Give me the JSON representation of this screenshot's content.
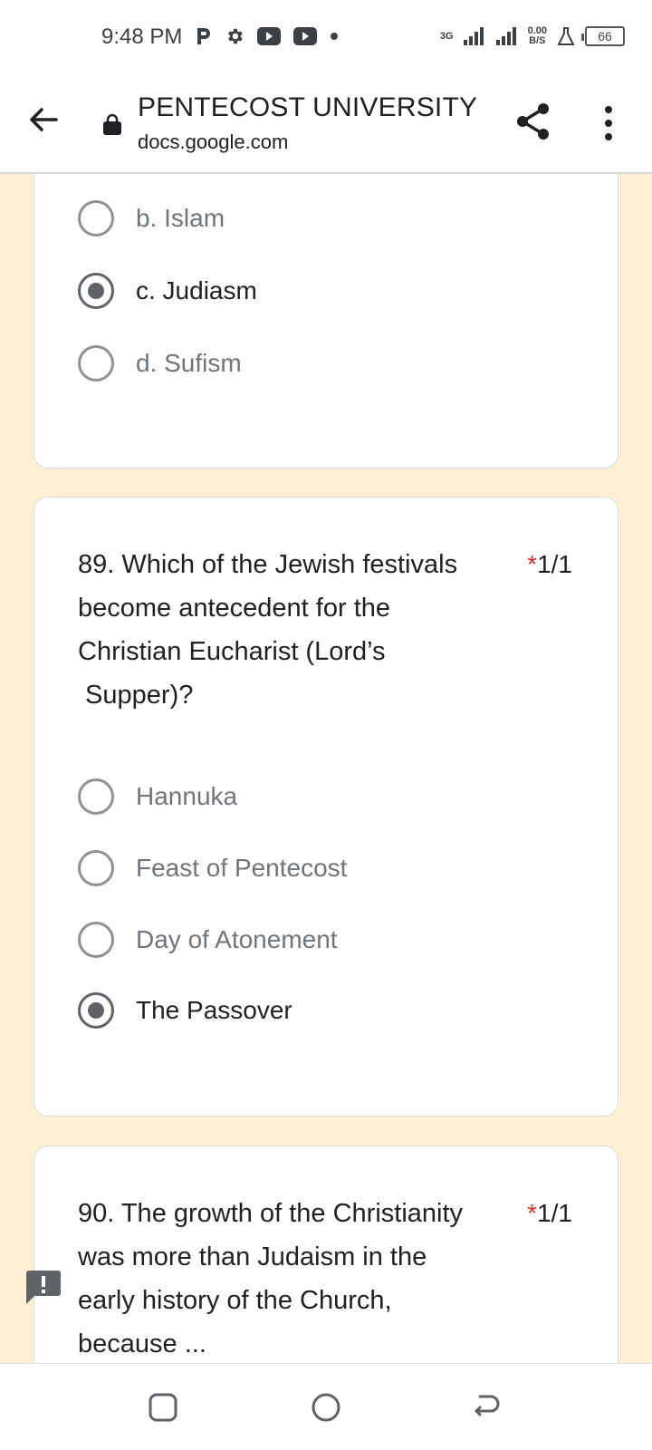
{
  "status_bar": {
    "time": "9:48 PM",
    "network_type": "3G",
    "data_speed_value": "0.00",
    "data_speed_unit": "B/S",
    "battery": "66",
    "left_icons": [
      "p-app-icon",
      "gear-icon",
      "video-icon",
      "youtube-icon",
      "dot-icon"
    ]
  },
  "app_bar": {
    "title": "PENTECOST UNIVERSITY",
    "url": "docs.google.com"
  },
  "card1": {
    "options": [
      {
        "label": "b. Islam",
        "selected": false
      },
      {
        "label": "c. Judiasm",
        "selected": true
      },
      {
        "label": "d. Sufism",
        "selected": false
      }
    ]
  },
  "card2": {
    "question_lines": [
      "89. Which of the Jewish festivals",
      "become antecedent for the",
      "Christian Eucharist (Lord’s",
      " Supper)?"
    ],
    "required_mark": "*",
    "points": "1/1",
    "options": [
      {
        "label": "Hannuka",
        "selected": false
      },
      {
        "label": "Feast of Pentecost",
        "selected": false
      },
      {
        "label": "Day of Atonement",
        "selected": false
      },
      {
        "label": "The Passover",
        "selected": true
      }
    ]
  },
  "card3": {
    "question_lines": [
      "90. The growth of the Christianity",
      "was more than Judaism in the",
      "early history of the Church,",
      "because ..."
    ],
    "required_mark": "*",
    "points": "1/1"
  },
  "colors": {
    "page_background": "#fdf0d3",
    "required_star": "#d93025",
    "radio_checked": "#5f6368"
  }
}
